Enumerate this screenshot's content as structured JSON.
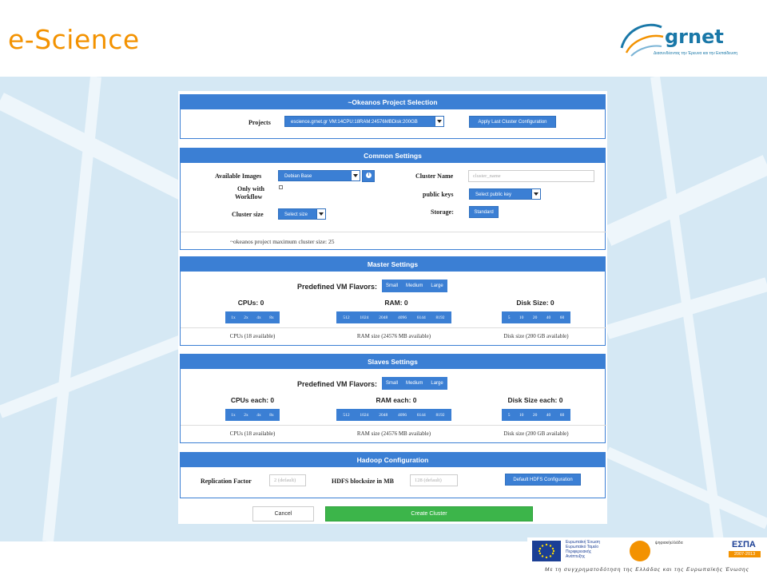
{
  "slide": {
    "title": "e-Science",
    "logo_text": "grnet",
    "logo_subtitle": "Διασυνδέοντας την Έρευνα και την Εκπαίδευση"
  },
  "okeanos_project": {
    "header": "~Okeanos Project Selection",
    "projects_label": "Projects",
    "project_selected": "escience.grnet.gr VM:14CPU:18RAM:24576MBDisk:200GB",
    "apply_last_label": "Apply Last Cluster Configuration"
  },
  "common_settings": {
    "header": "Common Settings",
    "available_images_label": "Available Images",
    "image_selected": "Debian Base",
    "only_with_workflow_label_line1": "Only with",
    "only_with_workflow_label_line2": "Workflow",
    "cluster_size_label": "Cluster size",
    "cluster_size_selected": "Select size",
    "cluster_name_label": "Cluster Name",
    "cluster_name_placeholder": "cluster_name",
    "public_keys_label": "public keys",
    "public_key_selected": "Select public key",
    "storage_label": "Storage:",
    "storage_button": "Standard",
    "max_cluster_note": "~okeanos project maximum cluster size: 25"
  },
  "master_settings": {
    "header": "Master Settings",
    "flavors_label": "Predefined VM Flavors:",
    "flavors": [
      "Small",
      "Medium",
      "Large"
    ],
    "cpus_head": "CPUs: 0",
    "ram_head": "RAM: 0",
    "disk_head": "Disk Size: 0",
    "cpu_options": [
      "1x",
      "2x",
      "4x",
      "8x"
    ],
    "ram_options": [
      "512",
      "1024",
      "2048",
      "4096",
      "6144",
      "8192"
    ],
    "disk_options": [
      "5",
      "10",
      "20",
      "40",
      "60"
    ],
    "cpus_available": "CPUs (18 available)",
    "ram_available": "RAM size (24576 MB available)",
    "disk_available": "Disk size (200 GB available)"
  },
  "slaves_settings": {
    "header": "Slaves Settings",
    "flavors_label": "Predefined VM Flavors:",
    "flavors": [
      "Small",
      "Medium",
      "Large"
    ],
    "cpus_head": "CPUs each: 0",
    "ram_head": "RAM each: 0",
    "disk_head": "Disk Size each: 0",
    "cpu_options": [
      "1x",
      "2x",
      "4x",
      "8x"
    ],
    "ram_options": [
      "512",
      "1024",
      "2048",
      "4096",
      "6144",
      "8192"
    ],
    "disk_options": [
      "5",
      "10",
      "20",
      "40",
      "60"
    ],
    "cpus_available": "CPUs (18 available)",
    "ram_available": "RAM size (24576 MB available)",
    "disk_available": "Disk size (200 GB available)"
  },
  "hadoop": {
    "header": "Hadoop Configuration",
    "replication_label": "Replication Factor",
    "replication_placeholder": "2 (default)",
    "blocksize_label": "HDFS blocksize in MB",
    "blocksize_placeholder": "128 (default)",
    "default_config_label": "Default HDFS Configuration"
  },
  "actions": {
    "cancel": "Cancel",
    "create": "Create Cluster"
  },
  "footer": {
    "eu_text": "Ευρωπαϊκή Ένωση\nΕυρωπαϊκό Ταμείο\nΠεριφερειακής\nΑνάπτυξης",
    "digital_text": "ψηφιακήελλάδα",
    "espa_title": "ΕΣΠΑ",
    "espa_years": "2007-2013",
    "caption": "Με τη συγχρηματοδότηση της Ελλάδας και της Ευρωπαϊκής Ένωσης"
  }
}
